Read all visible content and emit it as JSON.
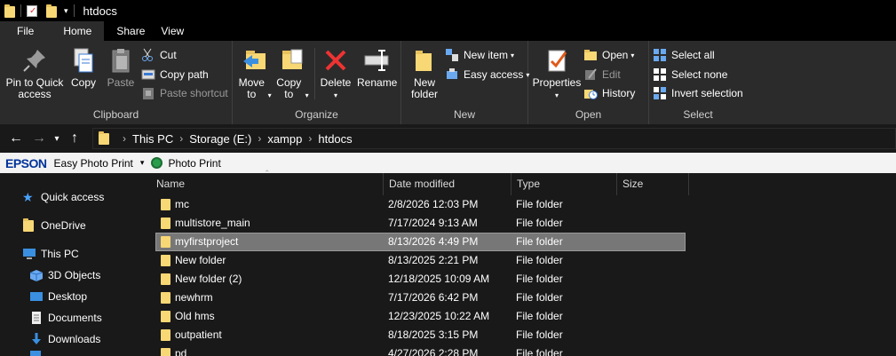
{
  "window": {
    "title": "htdocs"
  },
  "tabs": [
    {
      "label": "File"
    },
    {
      "label": "Home"
    },
    {
      "label": "Share"
    },
    {
      "label": "View"
    }
  ],
  "ribbon": {
    "clipboard": {
      "label": "Clipboard",
      "pin": "Pin to Quick access",
      "copy": "Copy",
      "paste": "Paste",
      "cut": "Cut",
      "copy_path": "Copy path",
      "paste_shortcut": "Paste shortcut"
    },
    "organize": {
      "label": "Organize",
      "move_to": "Move to",
      "copy_to": "Copy to",
      "delete": "Delete",
      "rename": "Rename"
    },
    "new": {
      "label": "New",
      "new_folder": "New folder",
      "new_item": "New item",
      "easy_access": "Easy access"
    },
    "open": {
      "label": "Open",
      "properties": "Properties",
      "open": "Open",
      "edit": "Edit",
      "history": "History"
    },
    "select": {
      "label": "Select",
      "select_all": "Select all",
      "select_none": "Select none",
      "invert": "Invert selection"
    }
  },
  "address": {
    "crumbs": [
      "This PC",
      "Storage (E:)",
      "xampp",
      "htdocs"
    ]
  },
  "epson": {
    "logo": "EPSON",
    "easy_photo_print": "Easy Photo Print",
    "photo_print": "Photo Print"
  },
  "nav": {
    "items": [
      {
        "label": "Quick access"
      },
      {
        "label": "OneDrive"
      },
      {
        "label": "This PC"
      },
      {
        "label": "3D Objects"
      },
      {
        "label": "Desktop"
      },
      {
        "label": "Documents"
      },
      {
        "label": "Downloads"
      }
    ]
  },
  "list": {
    "columns": [
      "Name",
      "Date modified",
      "Type",
      "Size"
    ],
    "rows": [
      {
        "name": "mc",
        "date": "2/8/2026 12:03 PM",
        "type": "File folder"
      },
      {
        "name": "multistore_main",
        "date": "7/17/2024 9:13 AM",
        "type": "File folder"
      },
      {
        "name": "myfirstproject",
        "date": "8/13/2026 4:49 PM",
        "type": "File folder"
      },
      {
        "name": "New folder",
        "date": "8/13/2025 2:21 PM",
        "type": "File folder"
      },
      {
        "name": "New folder (2)",
        "date": "12/18/2025 10:09 AM",
        "type": "File folder"
      },
      {
        "name": "newhrm",
        "date": "7/17/2026 6:42 PM",
        "type": "File folder"
      },
      {
        "name": "Old hms",
        "date": "12/23/2025 10:22 AM",
        "type": "File folder"
      },
      {
        "name": "outpatient",
        "date": "8/18/2025 3:15 PM",
        "type": "File folder"
      },
      {
        "name": "pd",
        "date": "4/27/2026 2:28 PM",
        "type": "File folder"
      }
    ]
  },
  "colors": {
    "ribbon_bg": "#2b2b2b",
    "window_bg": "#191919",
    "selection": "#777777",
    "folder": "#f8d775"
  }
}
